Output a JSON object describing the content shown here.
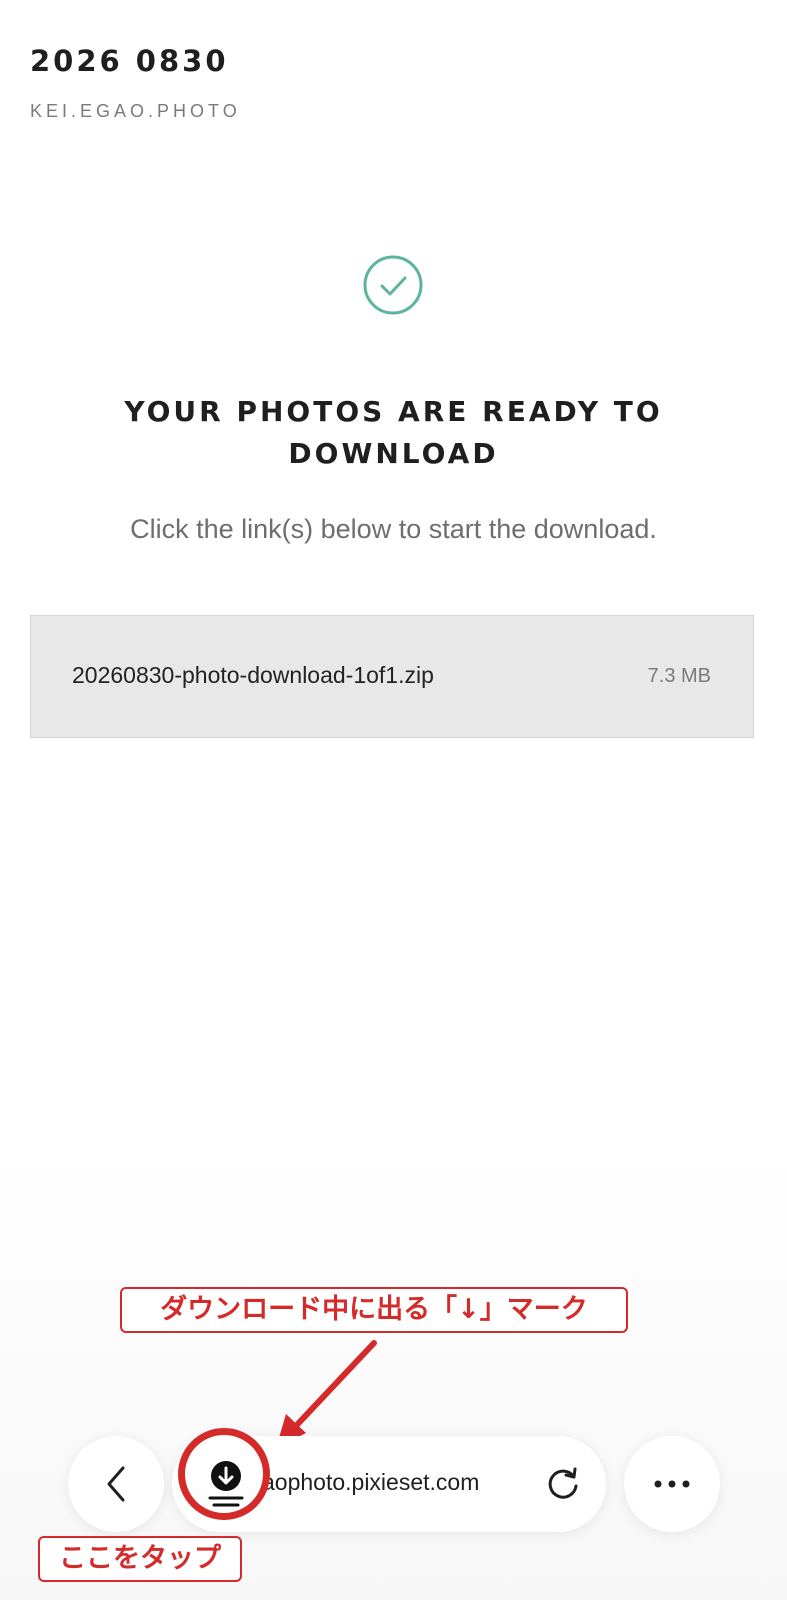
{
  "header": {
    "gallery_title": "2026 0830",
    "studio_name": "KEI.EGAO.PHOTO"
  },
  "status": {
    "icon": "check-circle-icon",
    "title_line1": "YOUR PHOTOS ARE READY TO",
    "title_line2": "DOWNLOAD",
    "subtitle": "Click the link(s) below to start the download."
  },
  "downloads": [
    {
      "file_name": "20260830-photo-download-1of1.zip",
      "size": "7.3 MB"
    }
  ],
  "browser_bar": {
    "url": "aophoto.pixieset.com",
    "icons": [
      "chevron-left-icon",
      "download-icon",
      "reload-icon",
      "more-icon"
    ]
  },
  "annotations": {
    "download_mark_note": "ダウンロード中に出る「↓」マーク",
    "tap_note": "ここをタップ"
  },
  "colors": {
    "accent_check": "#5bb59c",
    "annotation_red": "#d42a2a",
    "download_row_bg": "#e8e8e8"
  }
}
